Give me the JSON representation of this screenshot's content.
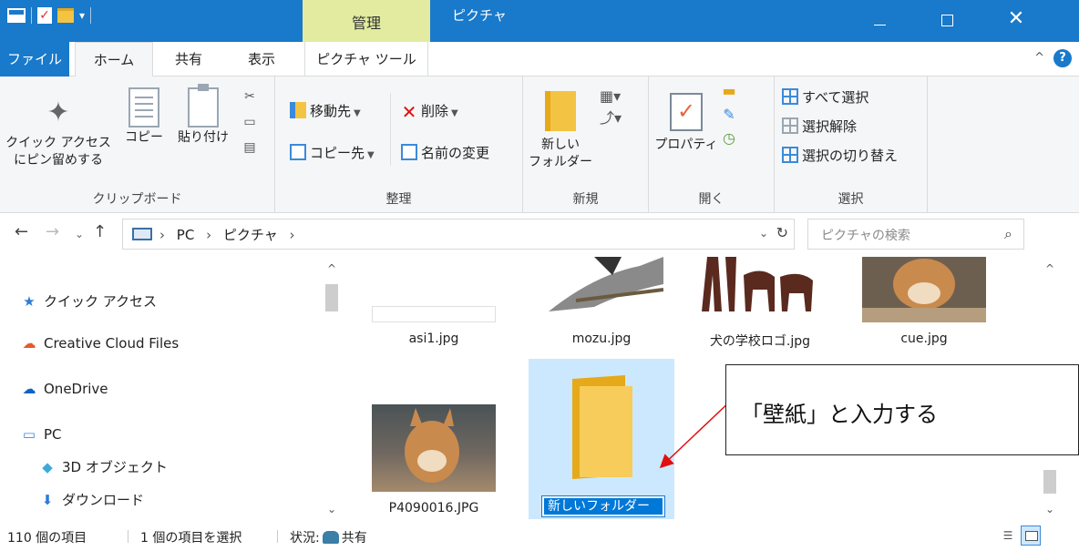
{
  "titlebar": {
    "context_tab": "管理",
    "title": "ピクチャ",
    "minimize": "—",
    "close": "✕"
  },
  "tabs": {
    "file": "ファイル",
    "home": "ホーム",
    "share": "共有",
    "view": "表示",
    "picture_tools": "ピクチャ ツール"
  },
  "ribbon": {
    "clipboard": {
      "pin_line1": "クイック アクセス",
      "pin_line2": "にピン留めする",
      "copy": "コピー",
      "paste": "貼り付け",
      "label": "クリップボード"
    },
    "organize": {
      "move_to": "移動先",
      "copy_to": "コピー先",
      "delete": "削除",
      "rename": "名前の変更",
      "label": "整理"
    },
    "new": {
      "new_folder_line1": "新しい",
      "new_folder_line2": "フォルダー",
      "label": "新規"
    },
    "open": {
      "properties": "プロパティ",
      "label": "開く"
    },
    "select": {
      "select_all": "すべて選択",
      "select_none": "選択解除",
      "invert": "選択の切り替え",
      "label": "選択"
    }
  },
  "address": {
    "crumbs": [
      "PC",
      "ピクチャ"
    ],
    "search_placeholder": "ピクチャの検索"
  },
  "nav": {
    "quick_access": "クイック アクセス",
    "creative_cloud": "Creative Cloud Files",
    "onedrive": "OneDrive",
    "pc": "PC",
    "objects3d": "3D オブジェクト",
    "downloads": "ダウンロード"
  },
  "files": [
    {
      "name": "asi1.jpg"
    },
    {
      "name": "mozu.jpg"
    },
    {
      "name": "犬の学校ロゴ.jpg"
    },
    {
      "name": "cue.jpg"
    },
    {
      "name": "P4090016.JPG"
    }
  ],
  "rename_value": "新しいフォルダー",
  "callout": "「壁紙」と入力する",
  "status": {
    "item_count": "110 個の項目",
    "selected": "1 個の項目を選択",
    "state_label": "状況:",
    "state_value": "共有"
  },
  "colors": {
    "accent": "#1979ca",
    "context_tab": "#e3eba0",
    "selection": "#cce8ff",
    "rename_highlight": "#0078d7"
  }
}
